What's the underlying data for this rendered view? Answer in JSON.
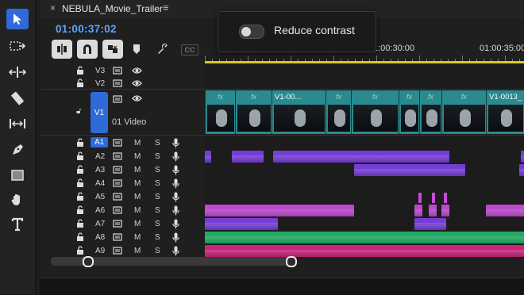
{
  "tab": {
    "close": "×",
    "title": "NEBULA_Movie_Trailer",
    "menu": "≡"
  },
  "timecode": "01:00:37:02",
  "toolbar": {
    "captions_label": "CC"
  },
  "ruler": {
    "labels": [
      "1:00:30:00",
      "01:00:35:00"
    ]
  },
  "toast": {
    "label": "Reduce contrast",
    "toggle_on": false
  },
  "tracks": {
    "video": [
      {
        "name": "V3"
      },
      {
        "name": "V2"
      },
      {
        "name": "V1",
        "title": "01 Video"
      }
    ],
    "audio": [
      {
        "name": "A1",
        "m": "M",
        "s": "S"
      },
      {
        "name": "A2",
        "m": "M",
        "s": "S"
      },
      {
        "name": "A3",
        "m": "M",
        "s": "S"
      },
      {
        "name": "A4",
        "m": "M",
        "s": "S"
      },
      {
        "name": "A5",
        "m": "M",
        "s": "S"
      },
      {
        "name": "A6",
        "m": "M",
        "s": "S"
      },
      {
        "name": "A7",
        "m": "M",
        "s": "S"
      },
      {
        "name": "A8",
        "m": "M",
        "s": "S"
      },
      {
        "name": "A9",
        "m": "M",
        "s": "S"
      }
    ]
  },
  "clips": {
    "fx": "fx",
    "names": [
      "V1-00...",
      "V1-0013_"
    ]
  },
  "colors": {
    "accent": "#2f6ad9",
    "timecode": "#5aa6ff",
    "audio_purple": "#7b3fe0",
    "audio_magenta": "#c64bd6",
    "audio_green": "#22b36a",
    "audio_pink": "#d1277e",
    "video_teal": "#2b8a8f"
  }
}
